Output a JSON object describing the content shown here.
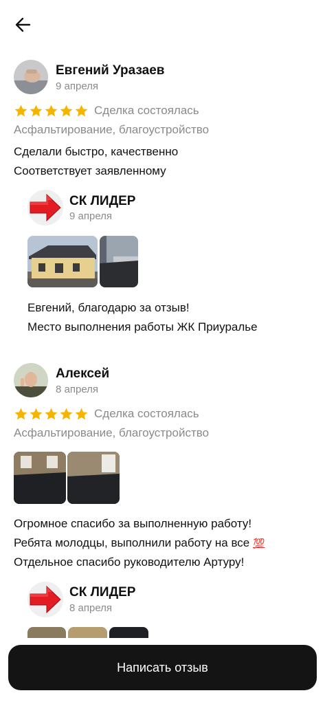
{
  "header": {
    "back_icon": "arrow-left-icon"
  },
  "reviews": [
    {
      "author": "Евгений Уразаев",
      "date": "9 апреля",
      "rating": 5,
      "deal_status": "Сделка состоялась",
      "category": "Асфальтирование, благоустройство",
      "text_lines": [
        "Сделали быстро, качественно",
        "Соответствует заявленному"
      ],
      "reply": {
        "company": "СК ЛИДЕР",
        "date": "9 апреля",
        "text_lines": [
          "Евгений, благодарю за отзыв!",
          "Место выполнения работы ЖК Приуралье"
        ]
      }
    },
    {
      "author": "Алексей",
      "date": "8 апреля",
      "rating": 5,
      "deal_status": "Сделка состоялась",
      "category": "Асфальтирование, благоустройство",
      "text_lines": [
        "Огромное спасибо за выполненную работу!",
        "Ребята молодцы, выполнили работу на все",
        "Отдельное спасибо руководителю Артуру!"
      ],
      "emoji": "💯",
      "reply": {
        "company": "СК ЛИДЕР",
        "date": "8 апреля"
      }
    }
  ],
  "footer": {
    "write_review_label": "Написать отзыв"
  },
  "colors": {
    "star": "#F5B400",
    "cta_bg": "#141414",
    "muted_text": "#8A8A8A",
    "logo_arrow": "#E31B23"
  }
}
